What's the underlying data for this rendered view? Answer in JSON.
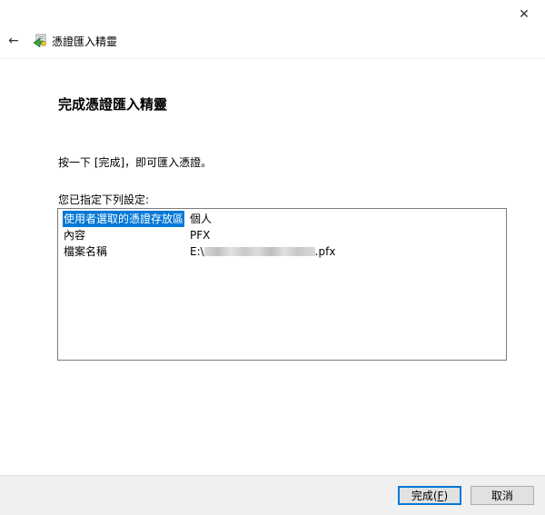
{
  "window": {
    "close_glyph": "✕",
    "back_glyph": "←",
    "wizard_title": "憑證匯入精靈"
  },
  "main": {
    "heading": "完成憑證匯入精靈",
    "instruction": "按一下 [完成]，即可匯入憑證。",
    "settings_label": "您已指定下列設定:",
    "settings": [
      {
        "name": "使用者選取的憑證存放區",
        "value": "個人",
        "selected": true
      },
      {
        "name": "內容",
        "value": "PFX"
      },
      {
        "name": "檔案名稱",
        "value_prefix": "E:\\",
        "value_suffix": ".pfx"
      }
    ]
  },
  "footer": {
    "finish_label": "完成(",
    "finish_accel": "F",
    "finish_close": ")",
    "cancel_label": "取消"
  },
  "colors": {
    "selection": "#0078d7",
    "footer_bg": "#f0f0f0"
  },
  "icons": {
    "close": "close-icon",
    "back": "back-arrow-icon",
    "wizard": "certificate-wizard-icon"
  }
}
